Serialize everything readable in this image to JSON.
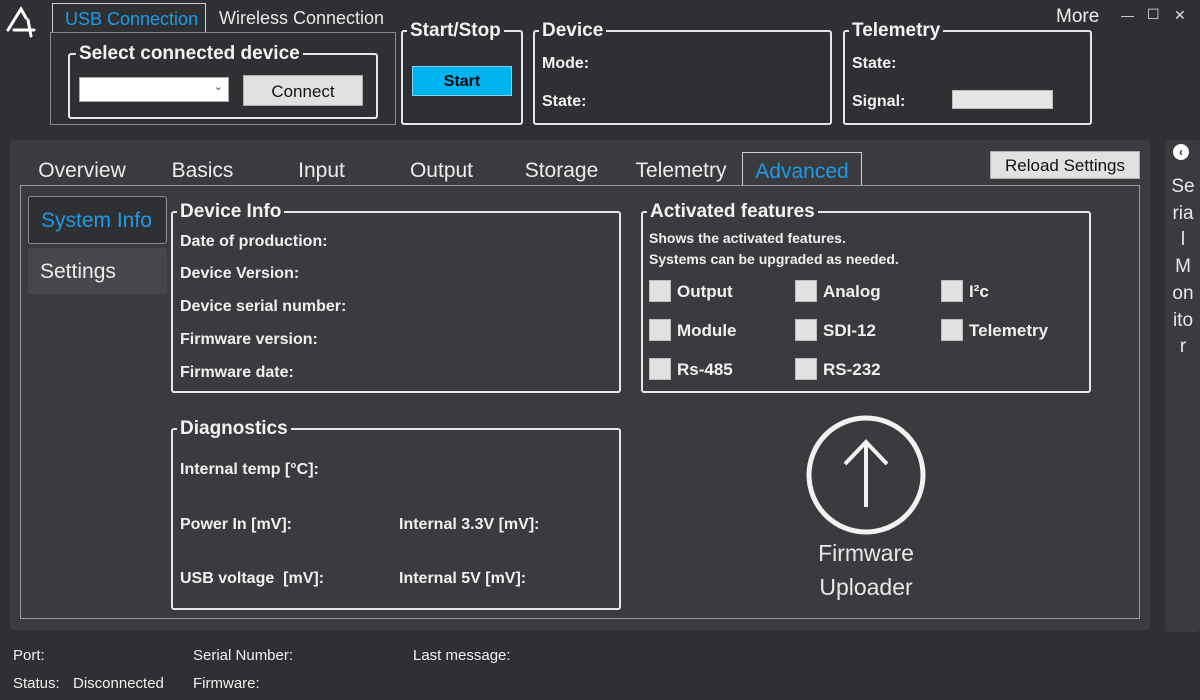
{
  "connection_tabs": {
    "usb": "USB Connection",
    "wireless": "Wireless Connection"
  },
  "window": {
    "more": "More",
    "minimize": "—",
    "maximize": "☐",
    "close": "✕"
  },
  "select_device": {
    "title": "Select connected device",
    "dropdown_value": "",
    "connect_label": "Connect"
  },
  "start_stop": {
    "title": "Start/Stop",
    "start_label": "Start"
  },
  "device": {
    "title": "Device",
    "mode_label": "Mode:",
    "state_label": "State:"
  },
  "telemetry": {
    "title": "Telemetry",
    "state_label": "State:",
    "signal_label": "Signal:"
  },
  "main_tabs": [
    "Overview",
    "Basics",
    "Input",
    "Output",
    "Storage",
    "Telemetry",
    "Advanced"
  ],
  "reload_label": "Reload Settings",
  "side_nav": [
    "System Info",
    "Settings"
  ],
  "device_info": {
    "title": "Device Info",
    "fields": [
      "Date of production:",
      "Device Version:",
      "Device serial number:",
      "Firmware version:",
      "Firmware date:"
    ]
  },
  "features": {
    "title": "Activated features",
    "desc1": "Shows the activated features.",
    "desc2": "Systems can be upgraded as needed.",
    "items": [
      "Output",
      "Analog",
      "I²c",
      "Module",
      "SDI-12",
      "Telemetry",
      "Rs-485",
      "RS-232"
    ]
  },
  "diagnostics": {
    "title": "Diagnostics",
    "internal_temp": "Internal temp [°C]:",
    "power_in": "Power In [mV]:",
    "internal_33": "Internal 3.3V [mV]:",
    "usb_voltage": "USB voltage  [mV]:",
    "internal_5": "Internal 5V [mV]:"
  },
  "firmware_uploader": {
    "line1": "Firmware",
    "line2": "Uploader"
  },
  "serial_monitor": {
    "label": "Serial Monitor",
    "toggle_icon": "chevron-left-icon"
  },
  "statusbar": {
    "port_label": "Port:",
    "status_label": "Status:",
    "status_value": "Disconnected",
    "serial_label": "Serial Number:",
    "firmware_label": "Firmware:",
    "last_message_label": "Last message:"
  },
  "colors": {
    "accent": "#1e9be6",
    "start_button": "#00b4f0",
    "background": "#2f3033",
    "panel": "#3a3b3e"
  }
}
